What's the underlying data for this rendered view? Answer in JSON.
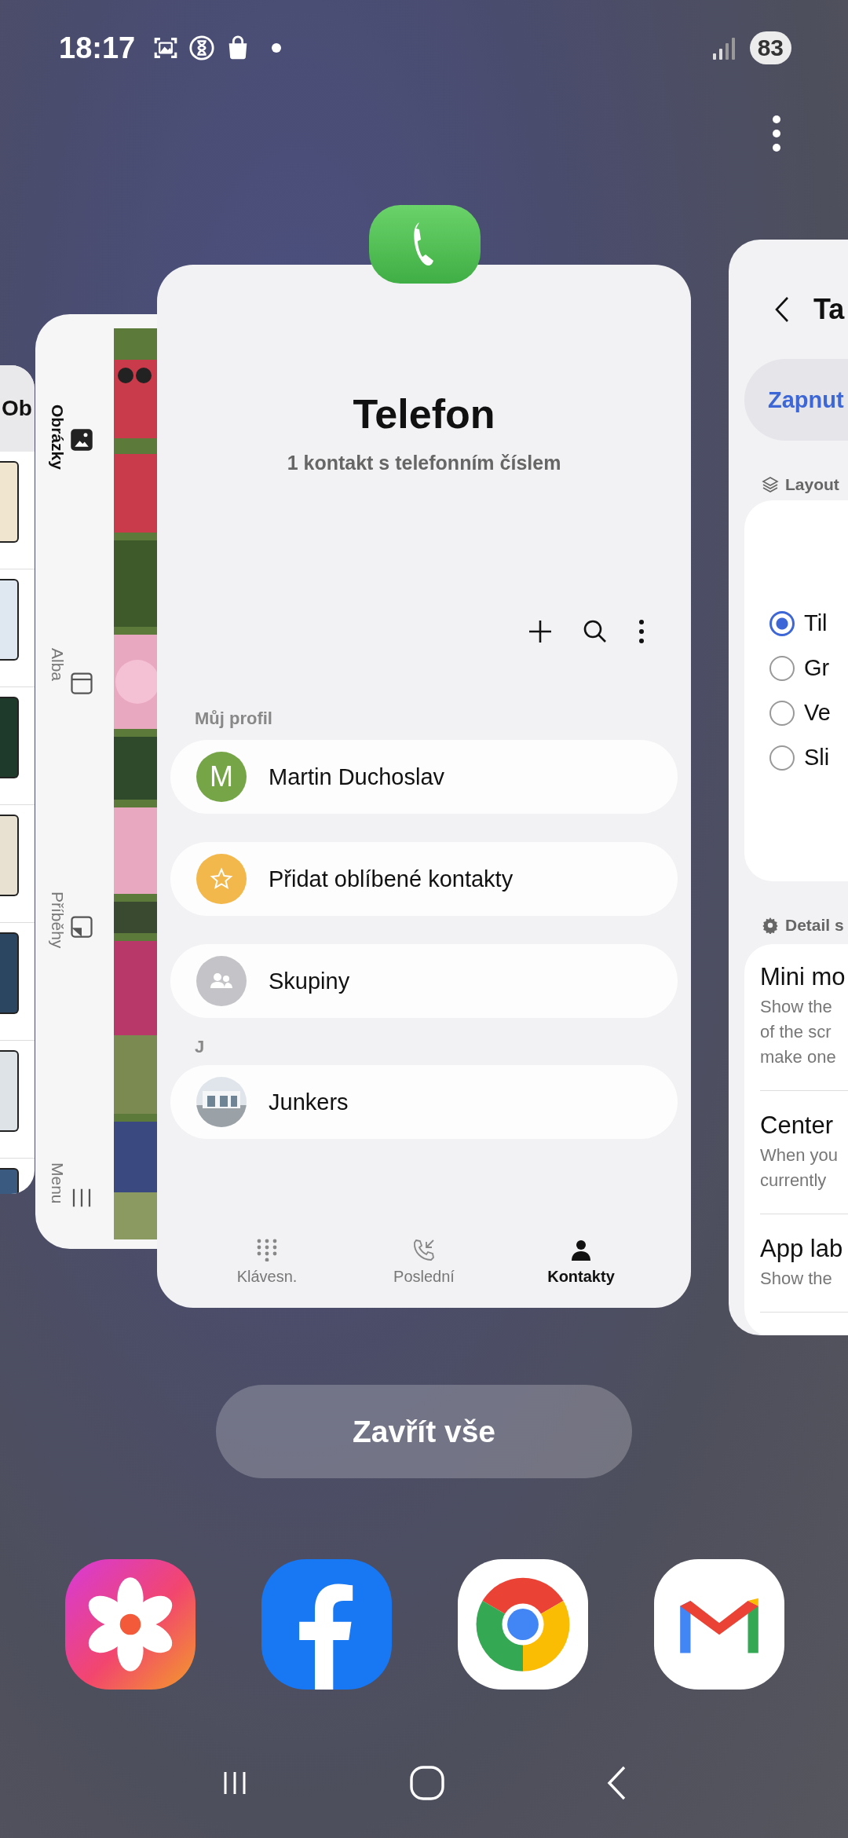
{
  "status_bar": {
    "time": "18:17",
    "battery": "83"
  },
  "list_card": {
    "title": "Ob"
  },
  "gallery_card": {
    "nav": [
      {
        "label": "Obrázky",
        "selected": true
      },
      {
        "label": "Alba",
        "selected": false
      },
      {
        "label": "Příběhy",
        "selected": false
      },
      {
        "label": "Menu",
        "selected": false
      }
    ]
  },
  "phone_card": {
    "title": "Telefon",
    "subtitle": "1 kontakt s telefonním číslem",
    "profile_header": "Můj profil",
    "rows": [
      {
        "kind": "letter",
        "avatar": "M",
        "name": "Martin Duchoslav",
        "color": "#76a548"
      },
      {
        "kind": "favorites",
        "name": "Přidat oblíbené kontakty",
        "color": "#f2b84b"
      },
      {
        "kind": "groups",
        "name": "Skupiny",
        "color": "#c4c4c8"
      }
    ],
    "section": "J",
    "contacts": [
      {
        "kind": "picture",
        "name": "Junkers"
      }
    ],
    "tabs": [
      {
        "label": "Klávesn.",
        "selected": false
      },
      {
        "label": "Poslední",
        "selected": false
      },
      {
        "label": "Kontakty",
        "selected": true
      }
    ]
  },
  "settings_card": {
    "title": "Ta",
    "toggle_label": "Zapnut",
    "layout_header": "Layout",
    "options": [
      {
        "label": "Til",
        "selected": true
      },
      {
        "label": "Gr",
        "selected": false
      },
      {
        "label": "Ve",
        "selected": false
      },
      {
        "label": "Sli",
        "selected": false
      }
    ],
    "detail_header": "Detail s",
    "items": [
      {
        "title": "Mini mo",
        "description": "Show the\nof the scr\nmake one"
      },
      {
        "title": "Center",
        "description": "When you\ncurrently"
      },
      {
        "title": "App lab",
        "description": "Show the"
      }
    ]
  },
  "close_all": "Zavřít vše"
}
